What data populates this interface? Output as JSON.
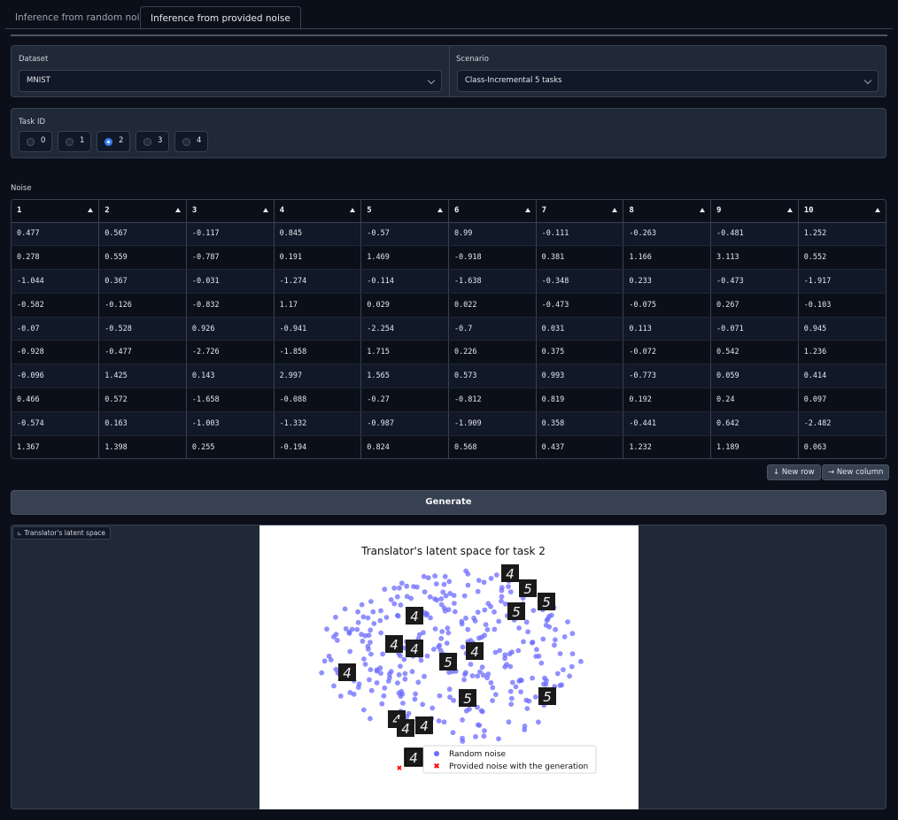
{
  "tabs": [
    {
      "label": "Inference from random noise",
      "active": false
    },
    {
      "label": "Inference from provided noise",
      "active": true
    }
  ],
  "dataset": {
    "label": "Dataset",
    "value": "MNIST"
  },
  "scenario": {
    "label": "Scenario",
    "value": "Class-Incremental 5 tasks"
  },
  "task": {
    "label": "Task ID",
    "options": [
      "0",
      "1",
      "2",
      "3",
      "4"
    ],
    "selected": "2"
  },
  "noise": {
    "label": "Noise",
    "headers": [
      "1",
      "2",
      "3",
      "4",
      "5",
      "6",
      "7",
      "8",
      "9",
      "10"
    ],
    "rows": [
      [
        "0.477",
        "0.567",
        "-0.117",
        "0.845",
        "-0.57",
        "0.99",
        "-0.111",
        "-0.263",
        "-0.481",
        "1.252"
      ],
      [
        "0.278",
        "0.559",
        "-0.787",
        "0.191",
        "1.469",
        "-0.918",
        "0.381",
        "1.166",
        "3.113",
        "0.552"
      ],
      [
        "-1.044",
        "0.367",
        "-0.031",
        "-1.274",
        "-0.114",
        "-1.638",
        "-0.348",
        "0.233",
        "-0.473",
        "-1.917"
      ],
      [
        "-0.582",
        "-0.126",
        "-0.832",
        "1.17",
        "0.029",
        "0.022",
        "-0.473",
        "-0.075",
        "0.267",
        "-0.103"
      ],
      [
        "-0.07",
        "-0.528",
        "0.926",
        "-0.941",
        "-2.254",
        "-0.7",
        "0.031",
        "0.113",
        "-0.071",
        "0.945"
      ],
      [
        "-0.928",
        "-0.477",
        "-2.726",
        "-1.858",
        "1.715",
        "0.226",
        "0.375",
        "-0.072",
        "0.542",
        "1.236"
      ],
      [
        "-0.096",
        "1.425",
        "0.143",
        "2.997",
        "1.565",
        "0.573",
        "0.993",
        "-0.773",
        "0.059",
        "0.414"
      ],
      [
        "0.466",
        "0.572",
        "-1.658",
        "-0.088",
        "-0.27",
        "-0.812",
        "0.819",
        "0.192",
        "0.24",
        "0.097"
      ],
      [
        "-0.574",
        "0.163",
        "-1.003",
        "-1.332",
        "-0.987",
        "-1.909",
        "0.358",
        "-0.441",
        "0.642",
        "-2.482"
      ],
      [
        "1.367",
        "1.398",
        "0.255",
        "-0.194",
        "0.824",
        "0.568",
        "0.437",
        "1.232",
        "1.189",
        "0.063"
      ]
    ]
  },
  "buttons": {
    "new_row": "New row",
    "new_column": "New column",
    "generate": "Generate"
  },
  "plot": {
    "tag": "Translator's latent space",
    "title": "Translator's latent space for task 2",
    "legend": [
      "Random noise",
      "Provided noise with the generation"
    ],
    "colors": {
      "random": "#6b6bff",
      "provided": "#ff0000"
    }
  }
}
